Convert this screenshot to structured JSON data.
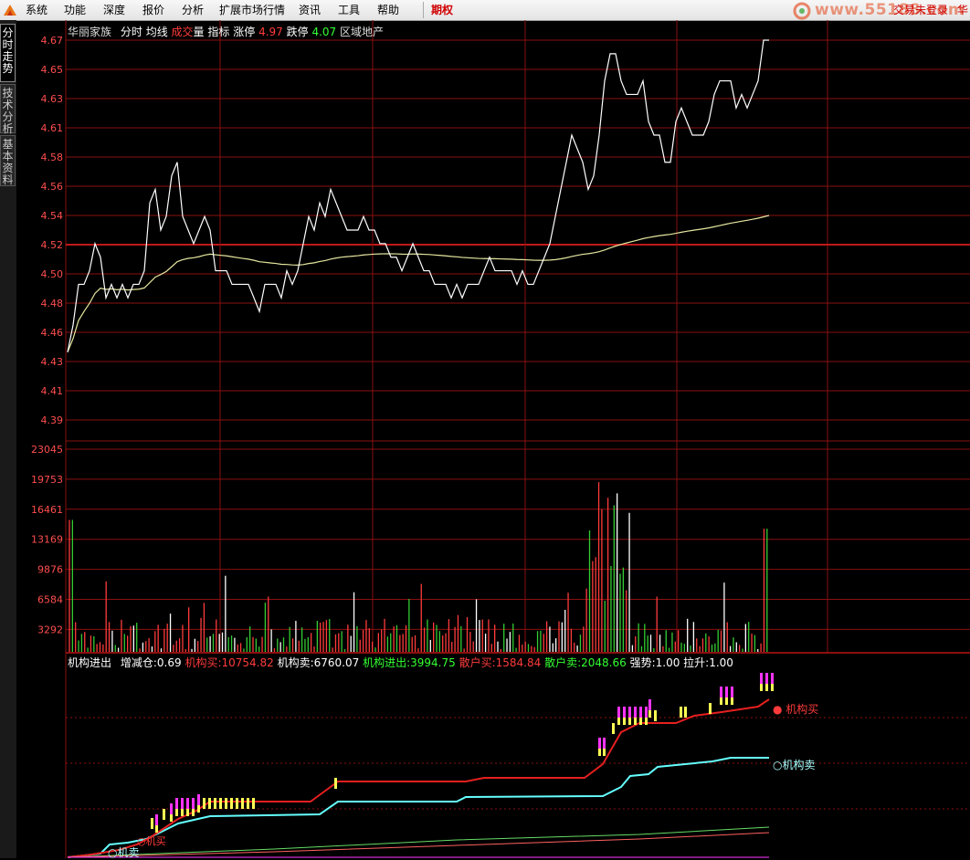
{
  "menu": {
    "items": [
      "系统",
      "功能",
      "深度",
      "报价",
      "分析",
      "扩展市场行情",
      "资讯",
      "工具",
      "帮助"
    ],
    "special": "期权",
    "brand_url": "www.55188.com",
    "login": "交易未登录",
    "right_char": "华"
  },
  "side_tabs": [
    {
      "label": "分时走势",
      "active": true
    },
    {
      "label": "技术分析",
      "active": false
    },
    {
      "label": "基本资料",
      "active": false
    }
  ],
  "price_panel": {
    "stock_name": "华丽家族",
    "mode": "分时",
    "avg_label": "均线",
    "vol_label_1": "成交",
    "vol_label_2": "量",
    "indicator_label": "指标",
    "limit_up_label": "涨停",
    "limit_up": "4.97",
    "limit_down_label": "跌停",
    "limit_down": "4.07",
    "sector": "区域地产",
    "ticks": [
      "4.67",
      "4.65",
      "4.63",
      "4.61",
      "4.58",
      "4.56",
      "4.54",
      "4.52",
      "4.50",
      "4.48",
      "4.46",
      "4.43",
      "4.41",
      "4.39"
    ],
    "ref_price": "4.52"
  },
  "volume_panel": {
    "ticks": [
      "23045",
      "19753",
      "16461",
      "13169",
      "9876",
      "6584",
      "3292"
    ]
  },
  "flow_panel": {
    "title": "机构进出",
    "items": [
      {
        "label": "增减仓:",
        "value": "0.69",
        "color": "#ffffff"
      },
      {
        "label": "机构买:",
        "value": "10754.82",
        "color": "#ff3b3b"
      },
      {
        "label": "机构卖:",
        "value": "6760.07",
        "color": "#ffffff"
      },
      {
        "label": "机构进出:",
        "value": "3994.75",
        "color": "#33ff33"
      },
      {
        "label": "散户买:",
        "value": "1584.84",
        "color": "#ff3b3b"
      },
      {
        "label": "散户卖:",
        "value": "2048.66",
        "color": "#33ff33"
      },
      {
        "label": "强势:",
        "value": "1.00",
        "color": "#ffffff"
      },
      {
        "label": "拉升:",
        "value": "1.00",
        "color": "#ffffff"
      }
    ],
    "label_buy": "机构买",
    "label_sell": "机构卖",
    "label_sell_lower": "机卖",
    "label_buy_lower": "机买"
  },
  "colors": {
    "grid_red": "#8a1010",
    "up": "#ff3b3b",
    "down": "#33cc33",
    "price_line": "#ffffff",
    "avg_line": "#e6e6a0",
    "buy_line": "#e62020",
    "sell_line": "#66ffff",
    "retail_buy": "#ff6060",
    "retail_sell": "#66dd66",
    "magenta": "#ff33ff",
    "yellow": "#ffff55"
  },
  "chart_data": {
    "type": "line",
    "ylim": [
      4.39,
      4.67
    ],
    "reference": 4.52,
    "price": [
      4.44,
      4.46,
      4.49,
      4.49,
      4.5,
      4.52,
      4.51,
      4.48,
      4.49,
      4.48,
      4.49,
      4.48,
      4.49,
      4.49,
      4.5,
      4.55,
      4.56,
      4.53,
      4.54,
      4.57,
      4.58,
      4.54,
      4.53,
      4.52,
      4.53,
      4.54,
      4.53,
      4.5,
      4.5,
      4.5,
      4.49,
      4.49,
      4.49,
      4.49,
      4.48,
      4.47,
      4.49,
      4.49,
      4.49,
      4.48,
      4.5,
      4.49,
      4.5,
      4.52,
      4.54,
      4.53,
      4.55,
      4.54,
      4.56,
      4.55,
      4.54,
      4.53,
      4.53,
      4.53,
      4.54,
      4.53,
      4.53,
      4.52,
      4.52,
      4.51,
      4.51,
      4.5,
      4.51,
      4.52,
      4.51,
      4.5,
      4.5,
      4.49,
      4.49,
      4.49,
      4.48,
      4.49,
      4.48,
      4.49,
      4.49,
      4.49,
      4.5,
      4.51,
      4.5,
      4.5,
      4.5,
      4.5,
      4.49,
      4.5,
      4.49,
      4.49,
      4.5,
      4.51,
      4.52,
      4.54,
      4.56,
      4.58,
      4.6,
      4.59,
      4.58,
      4.56,
      4.57,
      4.6,
      4.64,
      4.66,
      4.66,
      4.64,
      4.63,
      4.63,
      4.63,
      4.64,
      4.61,
      4.6,
      4.6,
      4.58,
      4.58,
      4.61,
      4.62,
      4.61,
      4.6,
      4.6,
      4.6,
      4.61,
      4.63,
      4.64,
      4.64,
      4.64,
      4.62,
      4.63,
      4.62,
      4.63,
      4.64,
      4.67,
      4.67
    ]
  }
}
